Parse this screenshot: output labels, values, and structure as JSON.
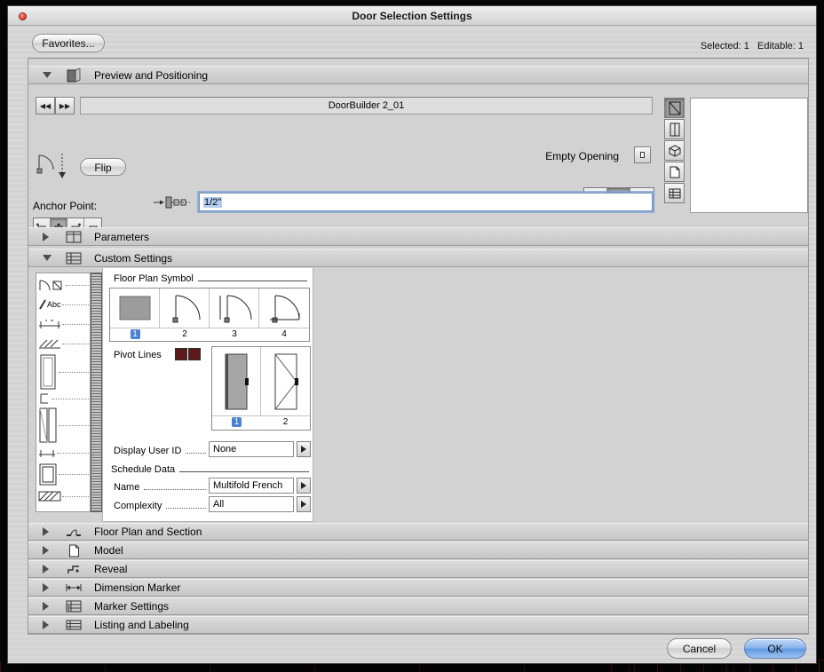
{
  "window": {
    "title": "Door Selection Settings",
    "favorites_label": "Favorites...",
    "selection_status": "Selected: 1   Editable: 1"
  },
  "icons": {
    "prev": "◀◀",
    "next": "▶▶"
  },
  "preview": {
    "section_label": "Preview and Positioning",
    "door_name": "DoorBuilder 2_01",
    "flip_label": "Flip",
    "empty_opening_label": "Empty Opening",
    "anchor_point_label": "Anchor Point:",
    "dimension_value": "1/2\""
  },
  "section_labels": {
    "parameters": "Parameters",
    "custom_settings": "Custom Settings",
    "floor_plan_and_section": "Floor Plan and Section",
    "model": "Model",
    "reveal": "Reveal",
    "dimension_marker": "Dimension Marker",
    "marker_settings": "Marker Settings",
    "listing_and_labeling": "Listing and Labeling"
  },
  "tree": {
    "abc_label": "Abc"
  },
  "custom": {
    "floor_plan_symbol_label": "Floor Plan Symbol",
    "floor_plan_options": [
      "1",
      "2",
      "3",
      "4"
    ],
    "floor_plan_selected": "1",
    "pivot_lines_label": "Pivot Lines",
    "panel_options": [
      "1",
      "2"
    ],
    "panel_selected": "1",
    "display_user_id_label": "Display User ID",
    "display_user_id_value": "None",
    "schedule_data_label": "Schedule Data",
    "name_label": "Name",
    "name_value": "Multifold French",
    "complexity_label": "Complexity",
    "complexity_value": "All"
  },
  "actions": {
    "cancel": "Cancel",
    "ok": "OK"
  },
  "colors": {
    "selection_highlight": "#4a7fd6",
    "pivot_swatch": "#5d1a1a",
    "ok_button": "#79a9e6",
    "focus_ring": "#78a0d7"
  }
}
